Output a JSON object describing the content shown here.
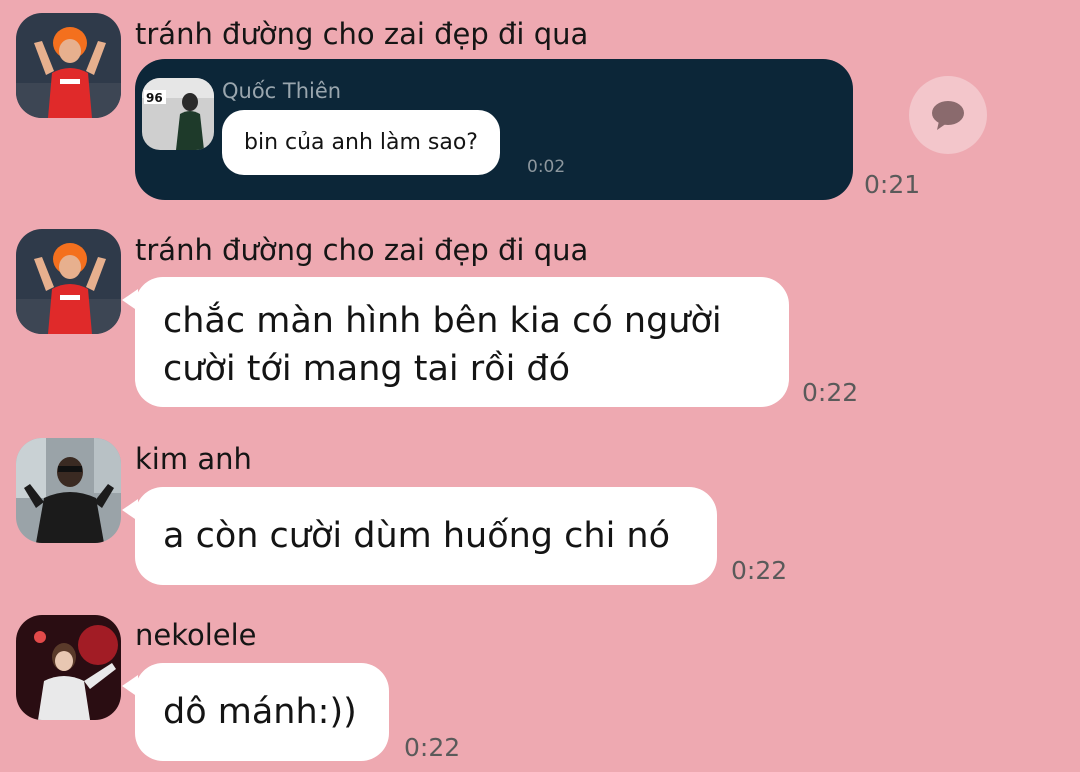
{
  "colors": {
    "background": "#eea9b1",
    "bubble": "#ffffff",
    "reply_card": "#0c2638",
    "comment_button": "#f3c6cb"
  },
  "messages": [
    {
      "sender": "tránh đường cho zai đẹp đi qua",
      "type": "shared_message",
      "quoted": {
        "name": "Quốc Thiên",
        "text": "bin của anh làm sao?",
        "time": "0:02",
        "thumb_icon": "person-photo"
      },
      "time": "0:21"
    },
    {
      "sender": "tránh đường cho zai đẹp đi qua",
      "type": "text",
      "lines": [
        "chắc màn hình bên kia có người",
        "cười tới mang tai rồi đó"
      ],
      "time": "0:22"
    },
    {
      "sender": "kim anh",
      "type": "text",
      "lines": [
        "a còn cười dùm huống chi nó"
      ],
      "time": "0:22"
    },
    {
      "sender": "nekolele",
      "type": "text",
      "lines": [
        "dô mánh:))"
      ],
      "time": "0:22"
    }
  ],
  "actions": {
    "comment_icon": "chat-bubble-icon"
  }
}
